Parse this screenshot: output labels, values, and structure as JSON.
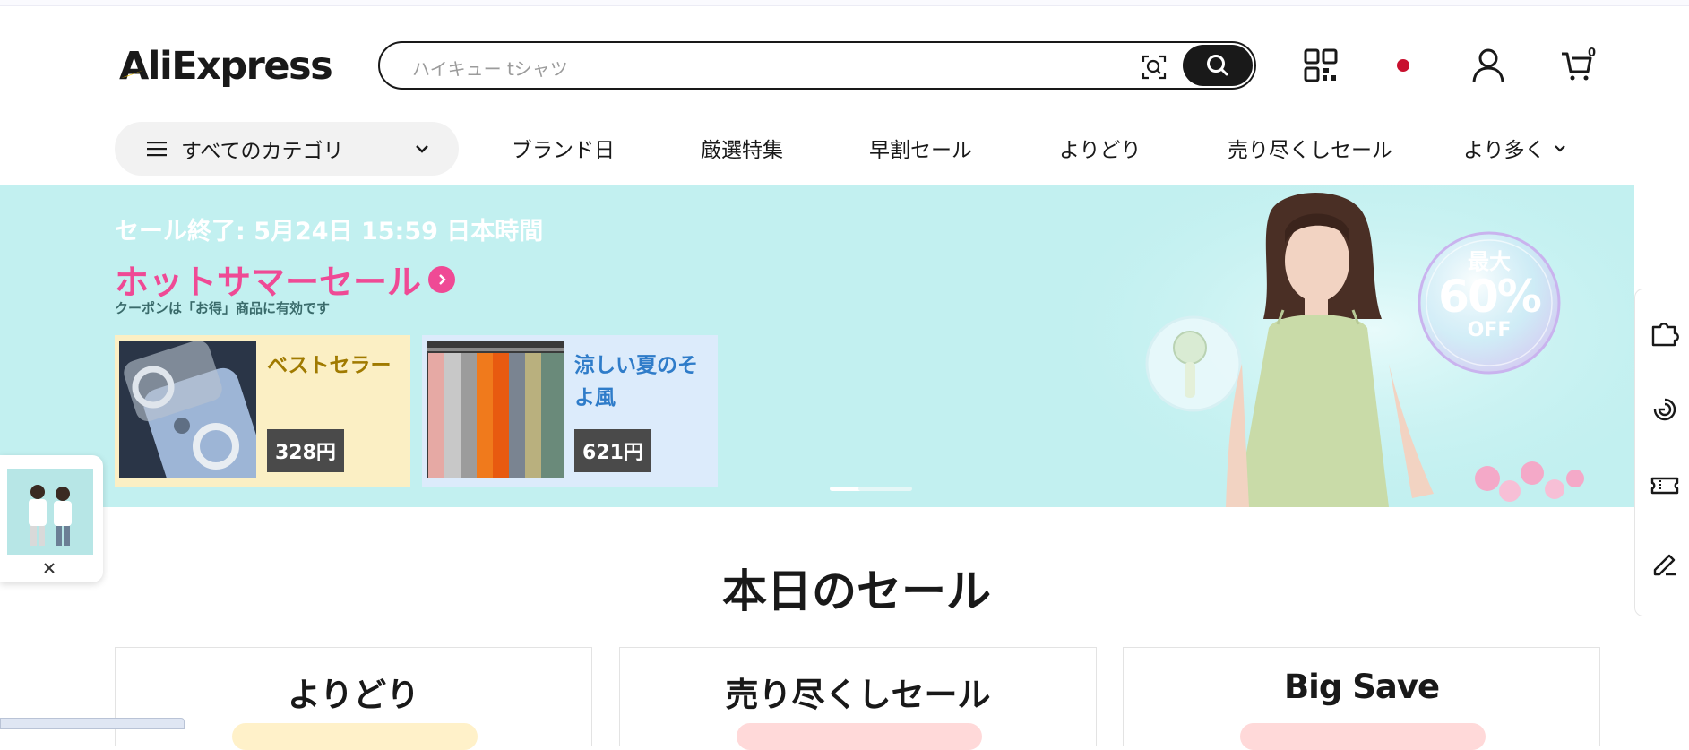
{
  "header": {
    "logo_text": "AliExpress",
    "search_placeholder": "ハイキュー tシャツ",
    "cart_count": "0",
    "icons": [
      "camera-search-icon",
      "search-icon",
      "qr-code-icon",
      "region-dot-icon",
      "account-icon",
      "cart-icon"
    ]
  },
  "nav": {
    "all_categories": "すべてのカテゴリ",
    "links": [
      "ブランド日",
      "厳選特集",
      "早割セール",
      "よりどり",
      "売り尽くしセール"
    ],
    "more": "より多く"
  },
  "banner": {
    "deadline": "セール終了: 5月24日 15:59 日本時間",
    "headline": "ホットサマーセール",
    "coupon_note": "クーポンは「お得」商品に有効です",
    "badge_top": "最大",
    "badge_pct": "60%",
    "badge_off": "OFF",
    "cards": [
      {
        "title": "ベストセラー",
        "price": "328円",
        "bg": "#fbefc4",
        "title_color": "#a07a00"
      },
      {
        "title": "涼しい夏のそよ風",
        "price": "621円",
        "bg": "#dcebfb",
        "title_color": "#2f7cc9"
      }
    ],
    "carousel_pages": 2,
    "carousel_active": 1
  },
  "sale": {
    "title": "本日のセール",
    "columns": [
      {
        "title": "よりどり",
        "pill": "#fff1c9"
      },
      {
        "title": "売り尽くしセール",
        "pill": "#ffd9d9"
      },
      {
        "title": "Big Save",
        "pill": "#ffd9d9"
      }
    ]
  },
  "side_rail": [
    "puzzle-icon",
    "spiral-icon",
    "ticket-icon",
    "edit-icon"
  ],
  "colors": {
    "banner_bg": "#c2f0f0",
    "headline_pink": "#ef4a95",
    "brand_dark": "#191919",
    "accent_red": "#c8102e"
  }
}
